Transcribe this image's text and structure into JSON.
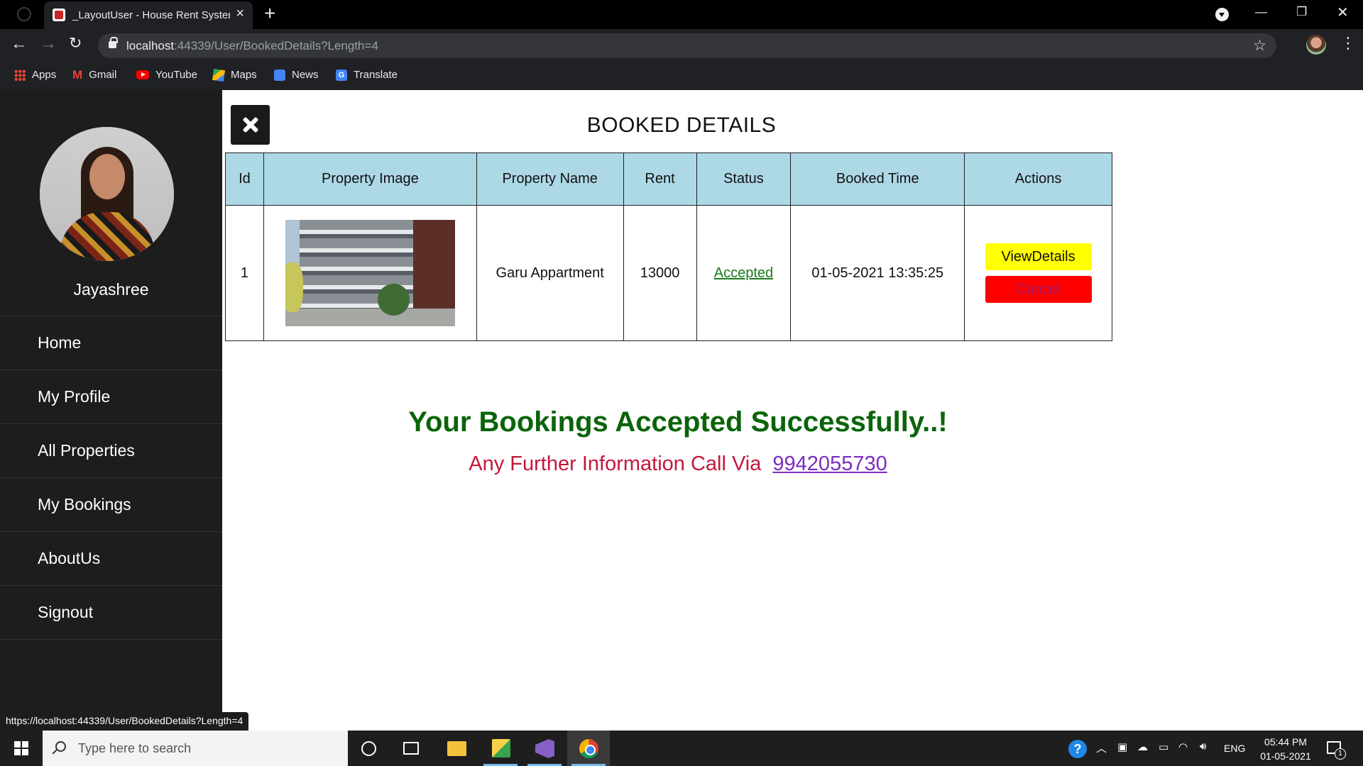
{
  "browser": {
    "tab_title": "_LayoutUser - House Rent System",
    "url_host": "localhost",
    "url_path": ":44339/User/BookedDetails?Length=4",
    "status_url": "https://localhost:44339/User/BookedDetails?Length=4"
  },
  "bookmarks": [
    "Apps",
    "Gmail",
    "YouTube",
    "Maps",
    "News",
    "Translate"
  ],
  "sidebar": {
    "user_name": "Jayashree",
    "menu": [
      "Home",
      "My Profile",
      "All Properties",
      "My Bookings",
      "AboutUs",
      "Signout"
    ]
  },
  "page": {
    "title": "BOOKED DETAILS",
    "table": {
      "headers": [
        "Id",
        "Property Image",
        "Property Name",
        "Rent",
        "Status",
        "Booked Time",
        "Actions"
      ],
      "rows": [
        {
          "id": "1",
          "property_name": "Garu Appartment",
          "rent": "13000",
          "status": "Accepted",
          "booked_time": "01-05-2021 13:35:25",
          "view_label": "ViewDetails",
          "cancel_label": "Cancel"
        }
      ]
    },
    "success_message": "Your Bookings Accepted Successfully..!",
    "info_text": "Any Further Information Call Via",
    "phone": "9942055730"
  },
  "taskbar": {
    "search_placeholder": "Type here to search",
    "language": "ENG",
    "time": "05:44 PM",
    "date": "01-05-2021",
    "notification_count": "1"
  },
  "colors": {
    "sidebar_bg": "#1d1d1d",
    "table_header_bg": "#add8e6",
    "success_green": "#0a640a",
    "info_red": "#c4173b",
    "view_button": "#ffff00",
    "cancel_button": "#ff0000"
  }
}
